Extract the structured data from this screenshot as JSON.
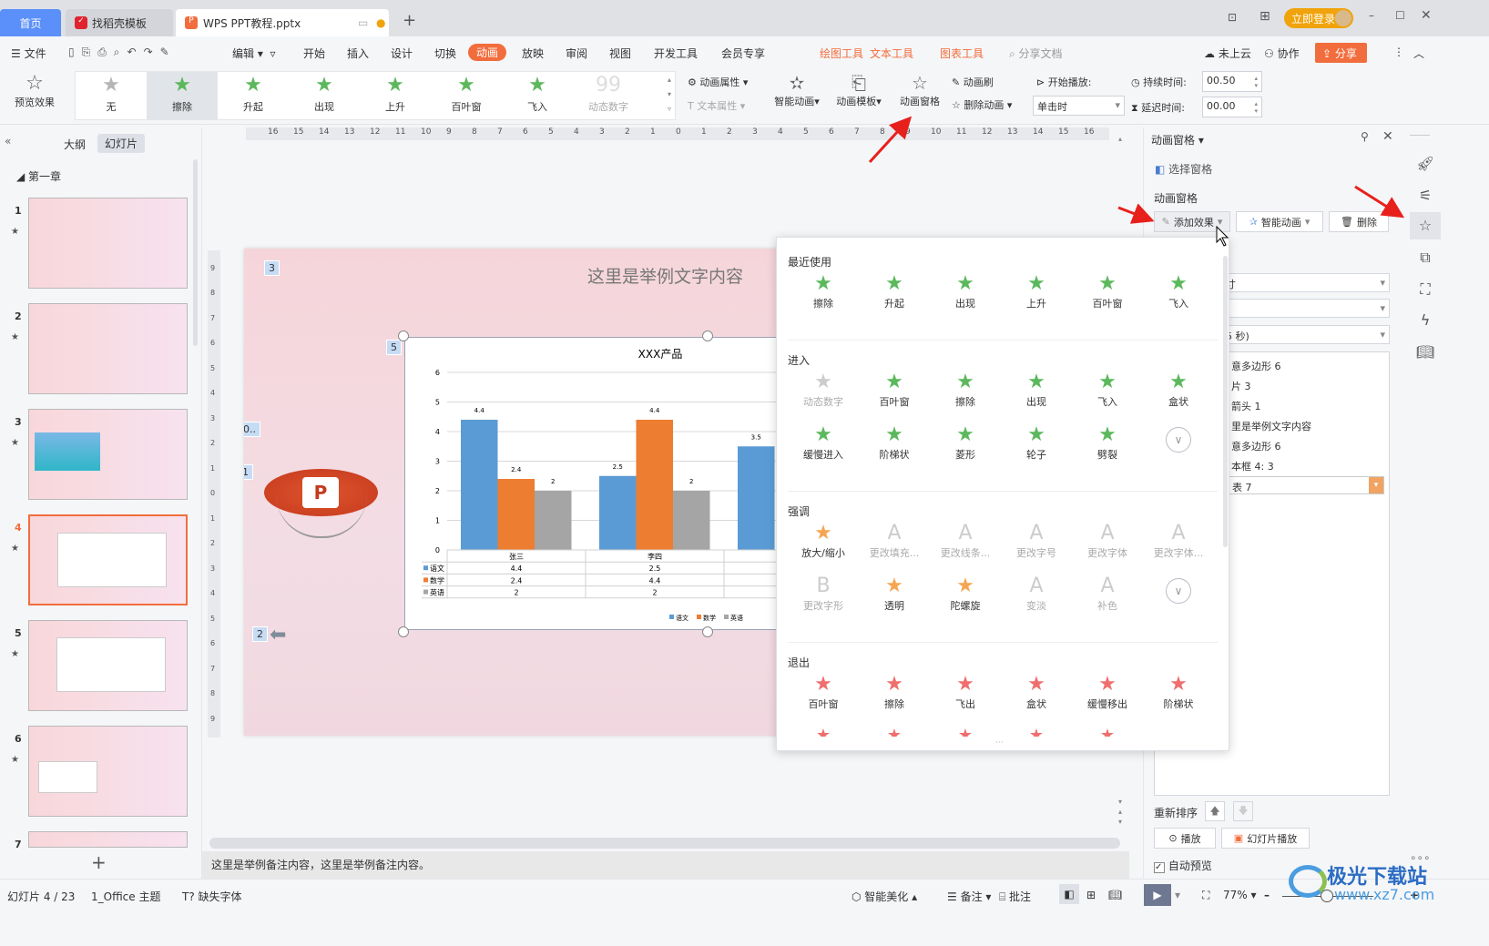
{
  "tabs": [
    {
      "label": "首页",
      "active": false,
      "home": true
    },
    {
      "label": "找稻壳模板"
    },
    {
      "label": "WPS PPT教程.pptx",
      "active": true
    }
  ],
  "window": {
    "login": "立即登录"
  },
  "menu": {
    "file": "文件",
    "edit": "编辑",
    "items": [
      "开始",
      "插入",
      "设计",
      "切换",
      "动画",
      "放映",
      "审阅",
      "视图",
      "开发工具",
      "会员专享"
    ],
    "active": "动画",
    "tools": [
      "绘图工具",
      "文本工具",
      "图表工具"
    ],
    "search": "分享文档",
    "cloud": "未上云",
    "collab": "协作",
    "share": "分享"
  },
  "ribbon": {
    "preview": "预览效果",
    "gallery": [
      {
        "label": "无",
        "icon": "star-grey"
      },
      {
        "label": "擦除",
        "icon": "star-wipe",
        "selected": true
      },
      {
        "label": "升起",
        "icon": "star-rise"
      },
      {
        "label": "出现",
        "icon": "star-appear"
      },
      {
        "label": "上升",
        "icon": "star-ascend"
      },
      {
        "label": "百叶窗",
        "icon": "star-blinds"
      },
      {
        "label": "飞入",
        "icon": "star-fly"
      },
      {
        "label": "动态数字",
        "icon": "number-99",
        "disabled": true
      }
    ],
    "anim_props": "动画属性",
    "text_props": "文本属性",
    "smart": "智能动画",
    "template": "动画模板",
    "pane": "动画窗格",
    "brush": "动画刷",
    "remove": "删除动画",
    "start_label": "开始播放:",
    "start_value": "单击时",
    "duration_label": "持续时间:",
    "duration": "00.50",
    "delay_label": "延迟时间:",
    "delay": "00.00"
  },
  "left": {
    "outline": "大纲",
    "slides": "幻灯片",
    "section": "第一章",
    "numbers": [
      "1",
      "2",
      "3",
      "4",
      "5",
      "6",
      "7"
    ],
    "selected": "4"
  },
  "slide": {
    "title": "这里是举例文字内容",
    "badges": [
      "3",
      "5",
      "0..",
      "1",
      "2"
    ]
  },
  "chart_data": {
    "type": "bar",
    "title": "XXX产品",
    "categories": [
      "张三",
      "李四",
      ""
    ],
    "series": [
      {
        "name": "语文",
        "values": [
          4.4,
          2.5,
          3.5
        ],
        "color": "#5b9bd5"
      },
      {
        "name": "数学",
        "values": [
          2.4,
          4.4,
          null
        ],
        "color": "#ed7d31"
      },
      {
        "name": "英语",
        "values": [
          2,
          2,
          null
        ],
        "color": "#a5a5a5"
      }
    ],
    "ylim": [
      0,
      6
    ],
    "yticks": [
      "0",
      "1",
      "2",
      "3",
      "4",
      "5",
      "6"
    ],
    "labels": {
      "s0": [
        "4.4",
        "2.5",
        "3.5"
      ],
      "s1": [
        "2.4",
        "4.4",
        ""
      ],
      "s2": [
        "2",
        "2",
        ""
      ]
    },
    "grid": true,
    "legend": "bottom"
  },
  "popup": {
    "sections": [
      {
        "title": "最近使用",
        "rows": [
          [
            {
              "l": "擦除",
              "c": "#5cb85c"
            },
            {
              "l": "升起",
              "c": "#5cb85c"
            },
            {
              "l": "出现",
              "c": "#5cb85c"
            },
            {
              "l": "上升",
              "c": "#5cb85c"
            },
            {
              "l": "百叶窗",
              "c": "#5cb85c"
            },
            {
              "l": "飞入",
              "c": "#5cb85c"
            }
          ]
        ]
      },
      {
        "title": "进入",
        "rows": [
          [
            {
              "l": "动态数字",
              "c": "#ccc",
              "d": true
            },
            {
              "l": "百叶窗",
              "c": "#5cb85c"
            },
            {
              "l": "擦除",
              "c": "#5cb85c"
            },
            {
              "l": "出现",
              "c": "#5cb85c"
            },
            {
              "l": "飞入",
              "c": "#5cb85c"
            },
            {
              "l": "盒状",
              "c": "#5cb85c"
            }
          ],
          [
            {
              "l": "缓慢进入",
              "c": "#5cb85c"
            },
            {
              "l": "阶梯状",
              "c": "#5cb85c"
            },
            {
              "l": "菱形",
              "c": "#5cb85c"
            },
            {
              "l": "轮子",
              "c": "#5cb85c"
            },
            {
              "l": "劈裂",
              "c": "#5cb85c"
            },
            {
              "expand": true
            }
          ]
        ]
      },
      {
        "title": "强调",
        "rows": [
          [
            {
              "l": "放大/缩小",
              "c": "#f5a552"
            },
            {
              "l": "更改填充...",
              "c": "#ccc",
              "d": true
            },
            {
              "l": "更改线条...",
              "c": "#ccc",
              "d": true
            },
            {
              "l": "更改字号",
              "c": "#ccc",
              "d": true
            },
            {
              "l": "更改字体",
              "c": "#ccc",
              "d": true
            },
            {
              "l": "更改字体...",
              "c": "#ccc",
              "d": true
            }
          ],
          [
            {
              "l": "更改字形",
              "c": "#ccc",
              "d": true
            },
            {
              "l": "透明",
              "c": "#f5a552"
            },
            {
              "l": "陀螺旋",
              "c": "#f5a552"
            },
            {
              "l": "变淡",
              "c": "#ccc",
              "d": true
            },
            {
              "l": "补色",
              "c": "#ccc",
              "d": true
            },
            {
              "expand": true
            }
          ]
        ]
      },
      {
        "title": "退出",
        "rows": [
          [
            {
              "l": "百叶窗",
              "c": "#ef6e6e"
            },
            {
              "l": "擦除",
              "c": "#ef6e6e"
            },
            {
              "l": "飞出",
              "c": "#ef6e6e"
            },
            {
              "l": "盒状",
              "c": "#ef6e6e"
            },
            {
              "l": "缓慢移出",
              "c": "#ef6e6e"
            },
            {
              "l": "阶梯状",
              "c": "#ef6e6e"
            }
          ]
        ]
      }
    ]
  },
  "rpanel": {
    "header": "动画窗格",
    "select_pane": "选择窗格",
    "title": "动画窗格",
    "add": "添加效果",
    "smart": "智能动画",
    "delete": "删除",
    "fields": [
      "寸",
      "",
      "5 秒)"
    ],
    "list": [
      "意多边形 6",
      "片 3",
      "箭头 1",
      "里是举例文字内容",
      "意多边形 6",
      "本框 4: 3",
      "表 7"
    ],
    "reorder": "重新排序",
    "play": "播放",
    "slideshow": "幻灯片播放",
    "autopreview": "自动预览",
    "autopreview_checked": true
  },
  "notes": "这里是举例备注内容，这里是举例备注内容。",
  "status": {
    "slide": "幻灯片 4 / 23",
    "theme": "1_Office 主题",
    "font": "缺失字体",
    "beautify": "智能美化",
    "notes": "备注",
    "comment": "批注",
    "zoom": "77%"
  },
  "watermark": {
    "name": "极光下载站",
    "url": "www.xz7.com"
  },
  "colors": {
    "accent": "#f26d3d",
    "home_tab": "#5b8ff9",
    "login": "#f0a30a"
  }
}
